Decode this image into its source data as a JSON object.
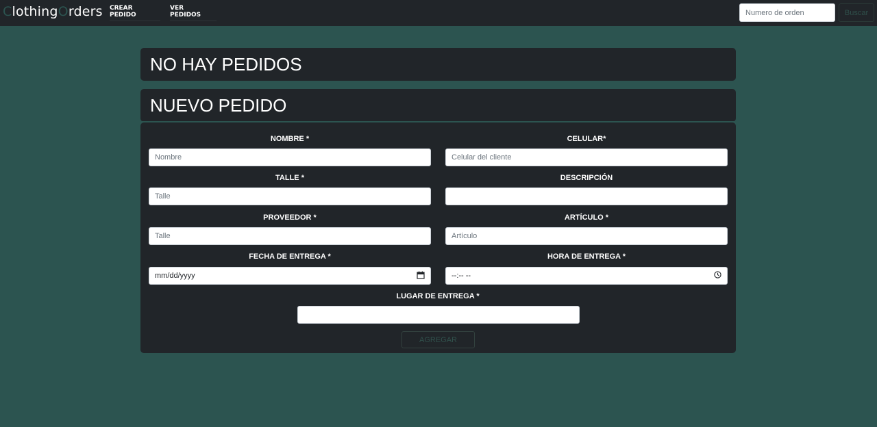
{
  "app": {
    "brand_first": "C",
    "brand_part1": "lothing",
    "brand_second": "O",
    "brand_part2": "rders"
  },
  "nav": {
    "items": [
      {
        "label": "CREAR PEDIDO"
      },
      {
        "label": "VER PEDIDOS"
      }
    ],
    "search": {
      "placeholder": "Numero de orden",
      "button_label": "Buscar"
    }
  },
  "orders_header": {
    "title": "NO HAY PEDIDOS"
  },
  "form": {
    "title": "NUEVO PEDIDO",
    "fields": {
      "nombre": {
        "label": "NOMBRE *",
        "placeholder": "Nombre"
      },
      "celular": {
        "label": "CELULAR*",
        "placeholder": "Celular del cliente"
      },
      "talle": {
        "label": "TALLE *",
        "placeholder": "Talle"
      },
      "descripcion": {
        "label": "DESCRIPCIÓN",
        "placeholder": ""
      },
      "proveedor": {
        "label": "PROVEEDOR *",
        "placeholder": "Talle"
      },
      "articulo": {
        "label": "ARTÍCULO *",
        "placeholder": "Artículo"
      },
      "fecha": {
        "label": "FECHA DE ENTREGA *",
        "value": "mm/dd/yyyy",
        "icon": "calendar-icon"
      },
      "hora": {
        "label": "HORA DE ENTREGA *",
        "value": "--:-- --",
        "icon": "clock-icon"
      },
      "lugar": {
        "label": "LUGAR DE ENTREGA *",
        "placeholder": ""
      }
    },
    "submit_label": "AGREGAR"
  },
  "colors": {
    "background": "#2c5450",
    "panel": "#212529",
    "text": "#ffffff"
  }
}
